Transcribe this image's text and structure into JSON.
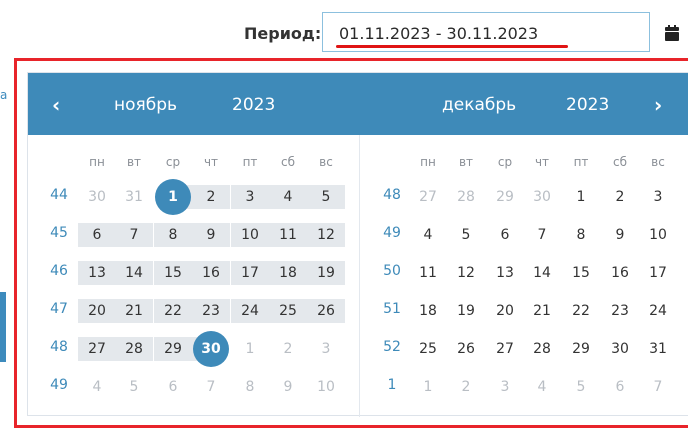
{
  "period": {
    "label": "Период:",
    "value": "01.11.2023 - 30.11.2023"
  },
  "calendar": {
    "prev_label": "‹",
    "next_label": "›",
    "weekdays": [
      "пн",
      "вт",
      "ср",
      "чт",
      "пт",
      "сб",
      "вс"
    ],
    "left": {
      "month": "ноябрь",
      "year": "2023",
      "weeks": [
        {
          "num": "44",
          "days": [
            "30",
            "31",
            "1",
            "2",
            "3",
            "4",
            "5"
          ]
        },
        {
          "num": "45",
          "days": [
            "6",
            "7",
            "8",
            "9",
            "10",
            "11",
            "12"
          ]
        },
        {
          "num": "46",
          "days": [
            "13",
            "14",
            "15",
            "16",
            "17",
            "18",
            "19"
          ]
        },
        {
          "num": "47",
          "days": [
            "20",
            "21",
            "22",
            "23",
            "24",
            "25",
            "26"
          ]
        },
        {
          "num": "48",
          "days": [
            "27",
            "28",
            "29",
            "30",
            "1",
            "2",
            "3"
          ]
        },
        {
          "num": "49",
          "days": [
            "4",
            "5",
            "6",
            "7",
            "8",
            "9",
            "10"
          ]
        }
      ]
    },
    "right": {
      "month": "декабрь",
      "year": "2023",
      "weeks": [
        {
          "num": "48",
          "days": [
            "27",
            "28",
            "29",
            "30",
            "1",
            "2",
            "3"
          ]
        },
        {
          "num": "49",
          "days": [
            "4",
            "5",
            "6",
            "7",
            "8",
            "9",
            "10"
          ]
        },
        {
          "num": "50",
          "days": [
            "11",
            "12",
            "13",
            "14",
            "15",
            "16",
            "17"
          ]
        },
        {
          "num": "51",
          "days": [
            "18",
            "19",
            "20",
            "21",
            "22",
            "23",
            "24"
          ]
        },
        {
          "num": "52",
          "days": [
            "25",
            "26",
            "27",
            "28",
            "29",
            "30",
            "31"
          ]
        },
        {
          "num": "1",
          "days": [
            "1",
            "2",
            "3",
            "4",
            "5",
            "6",
            "7"
          ]
        }
      ]
    },
    "colors": {
      "accent": "#3e8ab9",
      "range": "#e4e8ec",
      "highlight_border": "#e8242a"
    }
  }
}
